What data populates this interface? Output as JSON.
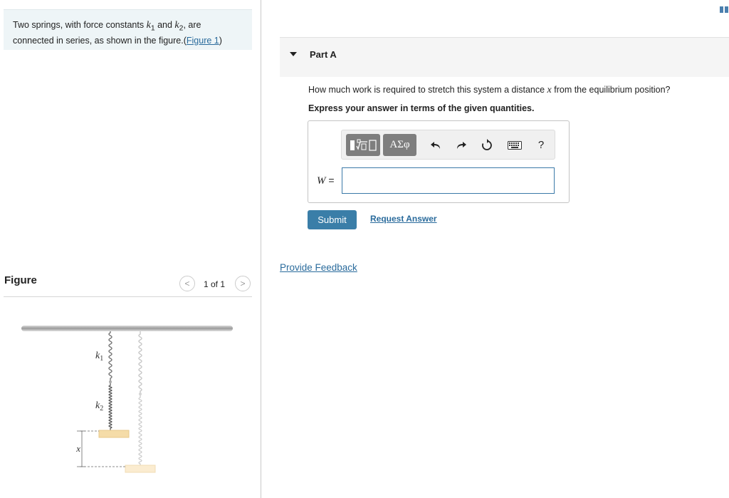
{
  "intro": {
    "text_before": "Two springs, with force constants ",
    "k1_var": "k",
    "k1_sub": "1",
    "text_and": " and ",
    "k2_var": "k",
    "k2_sub": "2",
    "text_after": ", are connected in series, as shown in the figure.(",
    "figure_link": "Figure 1",
    "text_close": ")"
  },
  "figure_panel": {
    "title": "Figure",
    "prev_glyph": "<",
    "next_glyph": ">",
    "count": "1 of 1",
    "labels": {
      "k1_var": "k",
      "k1_sub": "1",
      "k2_var": "k",
      "k2_sub": "2",
      "x": "x"
    }
  },
  "part": {
    "label": "Part A",
    "question_before": "How much work is required to stretch this system a distance ",
    "question_var": "x",
    "question_after": " from the equilibrium position?",
    "instruction": "Express your answer in terms of the given quantities."
  },
  "toolbar": {
    "greek_label": "ΑΣφ",
    "undo_glyph": "↶",
    "redo_glyph": "↷",
    "reset_glyph": "↻",
    "help_label": "?"
  },
  "answer": {
    "var_label": "W",
    "equals": " =",
    "value": ""
  },
  "actions": {
    "submit_label": "Submit",
    "request_label": "Request Answer",
    "feedback_label": "Provide Feedback"
  },
  "colors": {
    "accent": "#3a7ea8",
    "link": "#2a6b9c",
    "intro_bg": "#eef5f7",
    "toolbar_button": "#7e7e7e"
  }
}
